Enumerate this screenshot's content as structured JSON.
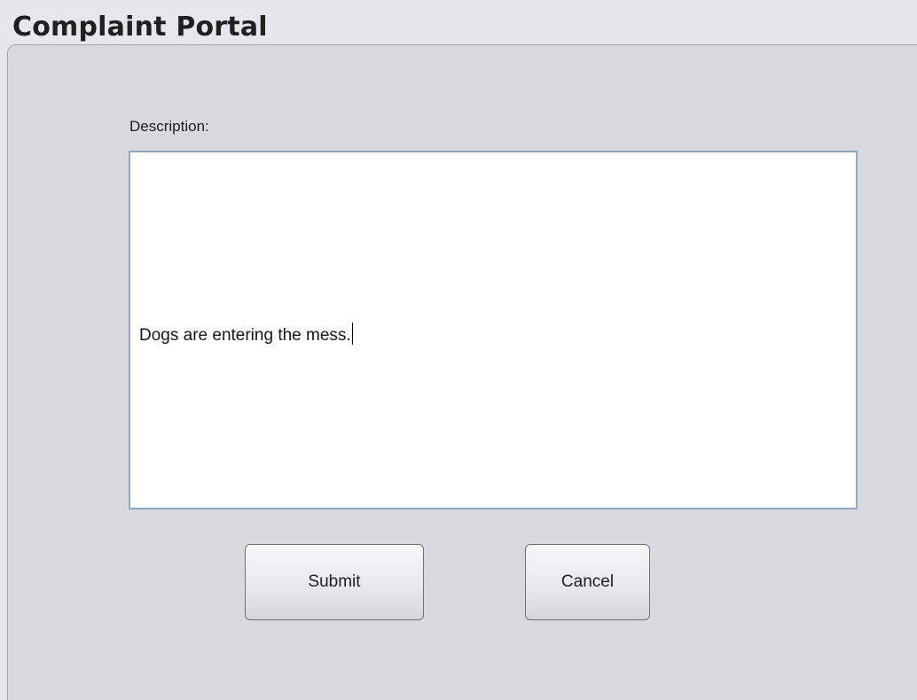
{
  "window": {
    "title": "Complaint Portal"
  },
  "form": {
    "description_label": "Description:",
    "description_value": "Dogs are entering the mess."
  },
  "buttons": {
    "submit_label": "Submit",
    "cancel_label": "Cancel"
  }
}
